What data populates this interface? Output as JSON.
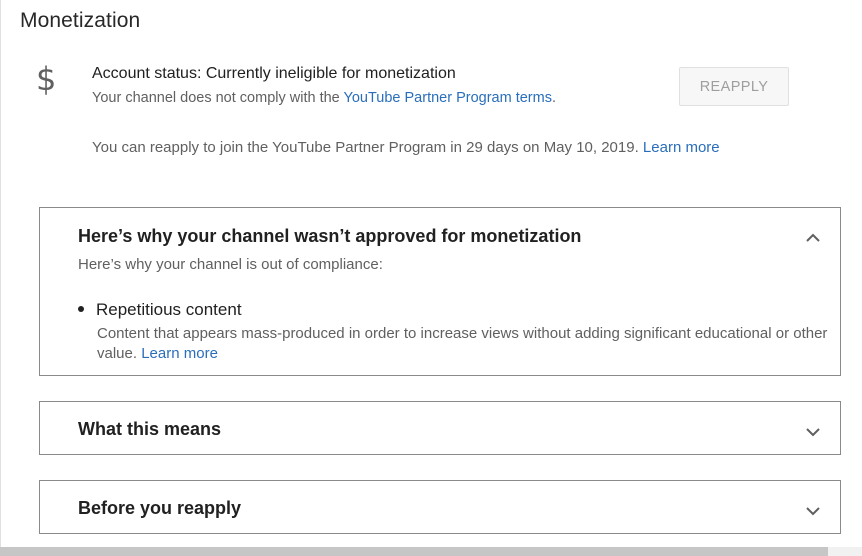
{
  "page": {
    "title": "Monetization"
  },
  "account_status": {
    "icon": "dollar-icon",
    "icon_glyph": "$",
    "title": "Account status: Currently ineligible for monetization",
    "subtitle_prefix": "Your channel does not comply with the ",
    "subtitle_link": "YouTube Partner Program terms",
    "subtitle_suffix": ".",
    "reapply_label": "REAPPLY",
    "reapply_note": "You can reapply to join the YouTube Partner Program in 29 days on May 10, 2019. ",
    "reapply_note_link": "Learn more"
  },
  "panels": [
    {
      "title": "Here’s why your channel wasn’t approved for monetization",
      "expanded": true,
      "description": "Here’s why your channel is out of compliance:",
      "reasons": [
        {
          "title": "Repetitious content",
          "description": "Content that appears mass-produced in order to increase views without adding significant educational or other value.  ",
          "link": "Learn more"
        }
      ]
    },
    {
      "title": "What this means",
      "expanded": false
    },
    {
      "title": "Before you reapply",
      "expanded": false
    }
  ],
  "colors": {
    "link": "#2a6ebb",
    "text_primary": "#212121",
    "text_secondary": "#606060",
    "panel_border": "#8a8a8a"
  }
}
